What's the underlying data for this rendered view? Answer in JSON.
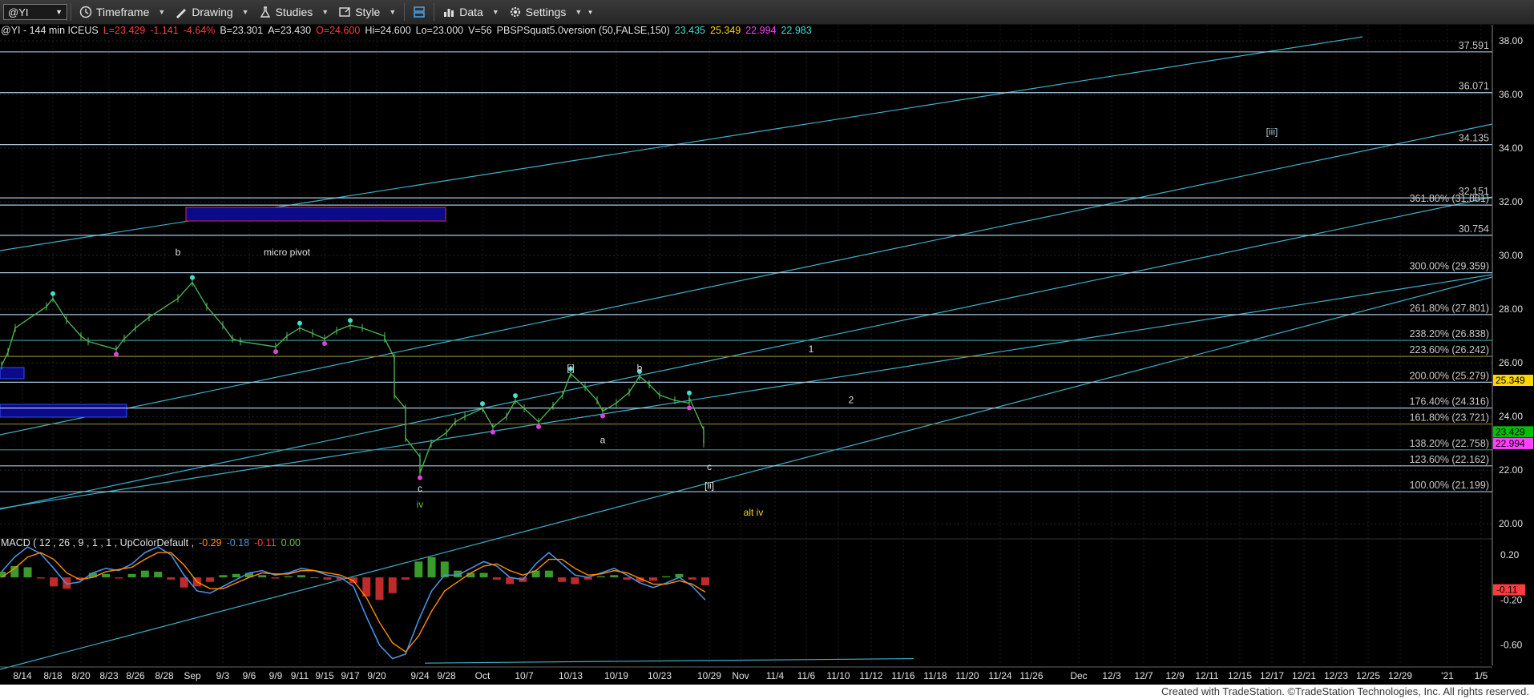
{
  "toolbar": {
    "symbol": "@YI",
    "items": [
      {
        "label": "Timeframe",
        "icon": "clock-icon"
      },
      {
        "label": "Drawing",
        "icon": "drawing-icon"
      },
      {
        "label": "Studies",
        "icon": "studies-icon"
      },
      {
        "label": "Style",
        "icon": "style-icon"
      },
      {
        "label": "Data",
        "icon": "data-icon"
      },
      {
        "label": "Settings",
        "icon": "gear-icon"
      }
    ]
  },
  "header": {
    "segments": [
      {
        "text": "@YI - 144 min  ICEUS",
        "color": "#e0e0e0"
      },
      {
        "text": "L=23.429",
        "color": "#ff3b3b"
      },
      {
        "text": "-1.141",
        "color": "#ff3b3b"
      },
      {
        "text": "-4.64%",
        "color": "#ff3b3b"
      },
      {
        "text": "B=23.301",
        "color": "#e0e0e0"
      },
      {
        "text": "A=23.430",
        "color": "#e0e0e0"
      },
      {
        "text": "O=24.600",
        "color": "#ff3b3b"
      },
      {
        "text": "Hi=24.600",
        "color": "#e0e0e0"
      },
      {
        "text": "Lo=23.000",
        "color": "#e0e0e0"
      },
      {
        "text": "V=56",
        "color": "#e0e0e0"
      },
      {
        "text": "PBSPSquat5.0version (50,FALSE,150)",
        "color": "#e0e0e0"
      },
      {
        "text": "23.435",
        "color": "#40e0d0"
      },
      {
        "text": "25.349",
        "color": "#ffd700"
      },
      {
        "text": "22.994",
        "color": "#ff40ff"
      },
      {
        "text": "22.983",
        "color": "#40e0d0"
      }
    ]
  },
  "chart_data": [
    {
      "type": "line",
      "name": "price",
      "y_ticks": [
        20,
        22,
        24,
        26,
        28,
        30,
        32,
        34,
        36,
        38
      ],
      "y_tick_labels": [
        "20.00",
        "22.00",
        "24.00",
        "26.00",
        "28.00",
        "30.00",
        "32.00",
        "34.00",
        "36.00",
        "38.00"
      ],
      "ylim": [
        19.5,
        38.6
      ],
      "x_tick_labels": [
        "8/14",
        "8/18",
        "8/20",
        "8/23",
        "8/26",
        "8/28",
        "Sep",
        "9/3",
        "9/6",
        "9/9",
        "9/11",
        "9/15",
        "9/17",
        "9/20",
        "9/24",
        "9/28",
        "Oct",
        "10/7",
        "10/13",
        "10/19",
        "10/23",
        "10/29",
        "Nov",
        "11/4",
        "11/6",
        "11/10",
        "11/12",
        "11/16",
        "11/18",
        "11/20",
        "11/24",
        "11/26",
        "Dec",
        "12/3",
        "12/7",
        "12/9",
        "12/11",
        "12/15",
        "12/17",
        "12/21",
        "12/23",
        "12/25",
        "12/29",
        "'21",
        "1/5"
      ],
      "price_series": [
        25.9,
        26.4,
        27.3,
        28.1,
        28.4,
        27.6,
        27.0,
        26.8,
        26.5,
        26.9,
        27.3,
        27.7,
        28.4,
        29.0,
        28.1,
        27.4,
        26.9,
        26.8,
        26.6,
        27.0,
        27.3,
        27.1,
        26.9,
        27.2,
        27.4,
        27.3,
        27.0,
        26.9,
        26.2,
        24.8,
        24.3,
        23.2,
        22.5,
        21.9,
        23.0,
        23.4,
        23.8,
        24.0,
        24.3,
        23.6,
        24.0,
        24.6,
        24.3,
        23.8,
        24.4,
        24.8,
        25.6,
        25.1,
        24.6,
        24.2,
        24.5,
        24.9,
        25.5,
        25.2,
        24.8,
        24.6,
        24.5,
        24.7,
        23.5,
        23.0
      ],
      "price_x_dates": [
        "8/11",
        "8/12",
        "8/13",
        "8/17",
        "8/18",
        "8/19",
        "8/20",
        "8/21",
        "8/24",
        "8/25",
        "8/26",
        "8/27",
        "8/31",
        "9/1",
        "9/2",
        "9/3",
        "9/4",
        "9/8",
        "9/9",
        "9/10",
        "9/11",
        "9/14",
        "9/15",
        "9/16",
        "9/17",
        "9/18",
        "9/21",
        "9/21",
        "9/22",
        "9/22",
        "9/23",
        "9/23",
        "9/24",
        "9/24",
        "9/25",
        "9/28",
        "9/29",
        "9/30",
        "10/1",
        "10/2",
        "10/5",
        "10/6",
        "10/7",
        "10/8",
        "10/9",
        "10/12",
        "10/13",
        "10/14",
        "10/15",
        "10/16",
        "10/19",
        "10/20",
        "10/21",
        "10/22",
        "10/23",
        "10/26",
        "10/27",
        "10/27",
        "10/28",
        "10/28"
      ],
      "fib_levels": [
        {
          "label": "37.591",
          "value": 37.591,
          "color": "#a8c8e0"
        },
        {
          "label": "36.071",
          "value": 36.071,
          "color": "#a8c8e0"
        },
        {
          "label": "34.135",
          "value": 34.135,
          "color": "#a8c8e0"
        },
        {
          "label": "32.151",
          "value": 32.151,
          "color": "#a8c8e0"
        },
        {
          "label": "361.80% (31.881)",
          "value": 31.881,
          "color": "#a8c8e0"
        },
        {
          "label": "30.754",
          "value": 30.754,
          "color": "#a8c8e0"
        },
        {
          "label": "300.00% (29.359)",
          "value": 29.359,
          "color": "#a8c8e0"
        },
        {
          "label": "261.80% (27.801)",
          "value": 27.801,
          "color": "#a8c8e0"
        },
        {
          "label": "238.20% (26.838)",
          "value": 26.838,
          "color": "#3a8c8c"
        },
        {
          "label": "223.60% (26.242)",
          "value": 26.242,
          "color": "#8c7c3a"
        },
        {
          "label": "200.00% (25.279)",
          "value": 25.279,
          "color": "#a8c8e0"
        },
        {
          "label": "176.40% (24.316)",
          "value": 24.316,
          "color": "#a8c8e0"
        },
        {
          "label": "161.80% (23.721)",
          "value": 23.721,
          "color": "#8c7c3a"
        },
        {
          "label": "138.20% (22.758)",
          "value": 22.758,
          "color": "#3a8c8c"
        },
        {
          "label": "123.60% (22.162)",
          "value": 22.162,
          "color": "#a8c8e0"
        },
        {
          "label": "100.00% (21.199)",
          "value": 21.199,
          "color": "#a8c8e0"
        }
      ],
      "price_tags": [
        {
          "label": "25.349",
          "value": 25.349,
          "bg": "#ffd700",
          "fg": "#000"
        },
        {
          "label": "23.429",
          "value": 23.429,
          "bg": "#00c000",
          "fg": "#000"
        },
        {
          "label": "22.994",
          "value": 22.994,
          "bg": "#ff40ff",
          "fg": "#000"
        }
      ],
      "wave_labels": [
        {
          "text": "b",
          "date": "8/31",
          "value": 30.0,
          "color": "#e0e0e0"
        },
        {
          "text": "micro pivot",
          "date": "9/10",
          "value": 30.0,
          "color": "#e0e0e0"
        },
        {
          "text": "[i]",
          "date": "10/13",
          "value": 25.7,
          "color": "#e0e0e0"
        },
        {
          "text": "b",
          "date": "10/21",
          "value": 25.7,
          "color": "#e0e0e0"
        },
        {
          "text": "a",
          "date": "10/16",
          "value": 23.0,
          "color": "#e0e0e0"
        },
        {
          "text": "c",
          "date": "9/24",
          "value": 21.2,
          "color": "#e0e0e0"
        },
        {
          "text": "iv",
          "date": "9/24",
          "value": 20.6,
          "color": "#6cc040"
        },
        {
          "text": "c",
          "date": "10/29",
          "value": 22.0,
          "color": "#e0e0e0"
        },
        {
          "text": "[ii]",
          "date": "10/29",
          "value": 21.3,
          "color": "#e0e0e0"
        },
        {
          "text": "alt iv",
          "date": "11/2",
          "value": 20.3,
          "color": "#ffd700"
        },
        {
          "text": "1",
          "date": "11/8",
          "value": 26.4,
          "color": "#e0e0e0"
        },
        {
          "text": "2",
          "date": "11/15",
          "value": 24.5,
          "color": "#e0e0e0"
        },
        {
          "text": "[iii]",
          "date": "12/17",
          "value": 34.5,
          "color": "#a8c8e0"
        }
      ]
    },
    {
      "type": "line",
      "name": "macd",
      "header": [
        {
          "text": "MACD ( 12 , 26 , 9 , 1 , 1 , UpColorDefault ,",
          "color": "#e0e0e0"
        },
        {
          "text": "-0.29",
          "color": "#ff8c00"
        },
        {
          "text": "-0.18",
          "color": "#4a90e2"
        },
        {
          "text": "-0.11",
          "color": "#ff3b3b"
        },
        {
          "text": "0.00",
          "color": "#6cc040"
        }
      ],
      "y_ticks": [
        0.2,
        -0.2,
        -0.6
      ],
      "y_tick_labels": [
        "0.20",
        "-0.20",
        "-0.60"
      ],
      "ylim": [
        -0.78,
        0.32
      ],
      "value_tag": {
        "label": "-0.11",
        "value": -0.11,
        "bg": "#ff3b3b"
      },
      "macd_series": [
        0.05,
        0.18,
        0.27,
        0.21,
        0.08,
        -0.06,
        -0.04,
        0.04,
        0.08,
        0.06,
        0.12,
        0.22,
        0.27,
        0.2,
        0.02,
        -0.12,
        -0.14,
        -0.08,
        -0.02,
        0.04,
        0.06,
        0.02,
        0.04,
        0.08,
        0.06,
        0.02,
        0.0,
        -0.08,
        -0.35,
        -0.6,
        -0.72,
        -0.68,
        -0.38,
        -0.12,
        0.02,
        0.02,
        0.08,
        0.14,
        0.1,
        0.0,
        -0.02,
        0.12,
        0.22,
        0.12,
        0.02,
        0.0,
        0.04,
        0.08,
        0.02,
        -0.05,
        -0.09,
        -0.05,
        0.0,
        -0.08,
        -0.2
      ],
      "signal_series": [
        0.0,
        0.08,
        0.18,
        0.22,
        0.16,
        0.04,
        -0.02,
        0.0,
        0.05,
        0.07,
        0.09,
        0.16,
        0.22,
        0.22,
        0.11,
        -0.04,
        -0.1,
        -0.1,
        -0.05,
        0.0,
        0.04,
        0.03,
        0.03,
        0.06,
        0.06,
        0.04,
        0.02,
        -0.03,
        -0.18,
        -0.4,
        -0.58,
        -0.66,
        -0.52,
        -0.3,
        -0.12,
        -0.04,
        0.04,
        0.1,
        0.12,
        0.06,
        0.02,
        0.06,
        0.16,
        0.16,
        0.08,
        0.02,
        0.03,
        0.06,
        0.04,
        -0.01,
        -0.06,
        -0.06,
        -0.03,
        -0.06,
        -0.13
      ]
    }
  ],
  "footer": {
    "text": "Created with TradeStation. ©TradeStation Technologies, Inc. All rights reserved."
  }
}
